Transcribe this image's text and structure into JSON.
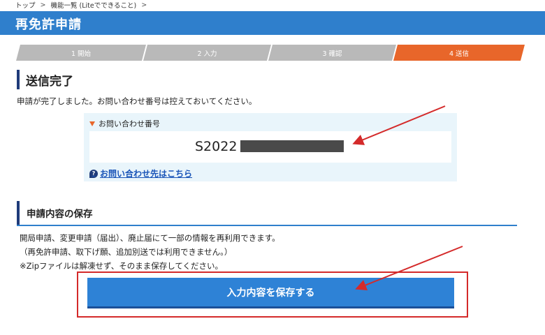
{
  "breadcrumb": {
    "items": [
      "トップ",
      "機能一覧 (Liteでできること)"
    ],
    "separator": ">"
  },
  "header": {
    "title": "再免許申請"
  },
  "steps": [
    {
      "label": "1 開始",
      "active": false
    },
    {
      "label": "2 入力",
      "active": false
    },
    {
      "label": "3 確認",
      "active": false
    },
    {
      "label": "4 送信",
      "active": true
    }
  ],
  "complete": {
    "title": "送信完了",
    "message": "申請が完了しました。お問い合わせ番号は控えておいてください。"
  },
  "inquiry": {
    "label": "お問い合わせ番号",
    "number_visible": "S2022",
    "help_link": "お問い合わせ先はこちら"
  },
  "save": {
    "title": "申請内容の保存",
    "lines": [
      "開局申請、変更申請（届出）、廃止届にて一部の情報を再利用できます。",
      "（再免許申請、取下げ願、追加別送では利用できません。）",
      "※Zipファイルは解凍せず、そのまま保存してください。"
    ],
    "button_label": "入力内容を保存する"
  },
  "colors": {
    "header": "#2f7fcc",
    "active_step": "#e8662a",
    "inactive_step": "#b9b9b9",
    "annotation": "#d42a2a",
    "button": "#2e82d6"
  }
}
